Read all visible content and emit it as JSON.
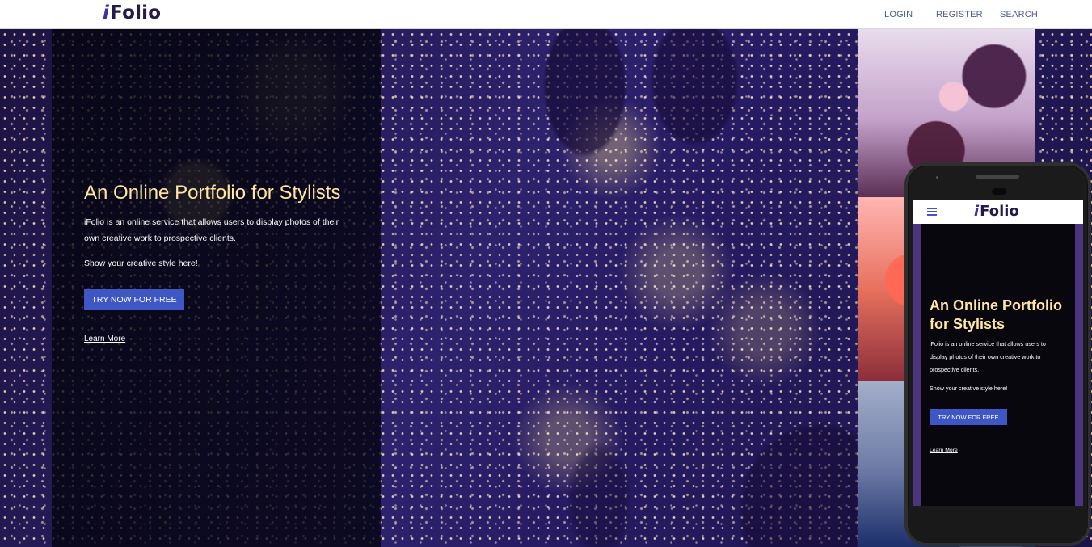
{
  "header": {
    "logo_prefix": "i",
    "logo_suffix": "Folio",
    "nav": {
      "login": "LOGIN",
      "register": "REGISTER",
      "search": "SEARCH"
    }
  },
  "hero": {
    "title": "An Online Portfolio for Stylists",
    "description": "iFolio is an online service that allows users to display photos of their own creative work to prospective clients.",
    "subtext": "Show your creative style here!",
    "cta_label": "TRY NOW FOR FREE",
    "learn_more": "Learn More"
  },
  "mobile_preview": {
    "logo_prefix": "i",
    "logo_suffix": "Folio",
    "title": "An Online Portfolio for Stylists",
    "description": "iFolio is an online service that allows users to display photos of their own creative work to prospective clients.",
    "subtext": "Show your creative style here!",
    "cta_label": "TRY NOW FOR FREE",
    "learn_more": "Learn More"
  },
  "icons": {
    "mobile_menu": "hamburger-menu-icon"
  },
  "colors": {
    "brand_dark": "#241b4a",
    "brand_accent": "#3f2fa0",
    "hero_title": "#ffe6a2",
    "button": "#3f56c5",
    "nav_text": "#4e5e8a"
  }
}
